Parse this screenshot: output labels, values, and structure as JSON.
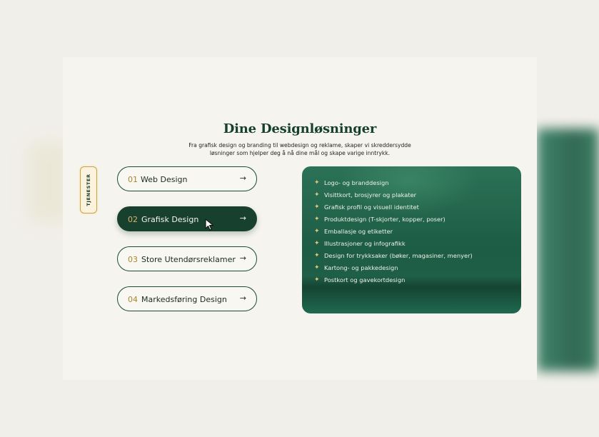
{
  "section": {
    "title": "Dine Designløsninger",
    "subtitle_line1": "Fra grafisk design og branding til webdesign og reklame, skaper vi skreddersydde",
    "subtitle_line2": "løsninger som hjelper deg å nå dine mål og skape varige inntrykk.",
    "tag": "TJENESTER"
  },
  "services": [
    {
      "num": "01",
      "name": "Web Design",
      "arrow": "→",
      "active": false
    },
    {
      "num": "02",
      "name": "Grafisk Design",
      "arrow": "→",
      "active": true
    },
    {
      "num": "03",
      "name": "Store Utendørsreklamer",
      "arrow": "→",
      "active": false
    },
    {
      "num": "04",
      "name": "Markedsføring Design",
      "arrow": "→",
      "active": false
    }
  ],
  "panel": {
    "bullet": "✦",
    "items": [
      "Logo- og branddesign",
      "Visittkort, brosjyrer og plakater",
      "Grafisk profil og visuell identitet",
      "Produktdesign (T-skjorter, kopper, poser)",
      "Emballasje og etiketter",
      "Illustrasjoner og infografikk",
      "Design for trykksaker (bøker, magasiner, menyer)",
      "Kartong- og pakkedesign",
      "Postkort og gavekortdesign"
    ]
  },
  "colors": {
    "accent": "#18402f",
    "gold": "#c7a24a",
    "background": "#f6f4ef"
  },
  "icons": {
    "cursor": "cursor-arrow-icon",
    "arrow": "arrow-right-icon",
    "bullet": "sparkle-icon"
  }
}
